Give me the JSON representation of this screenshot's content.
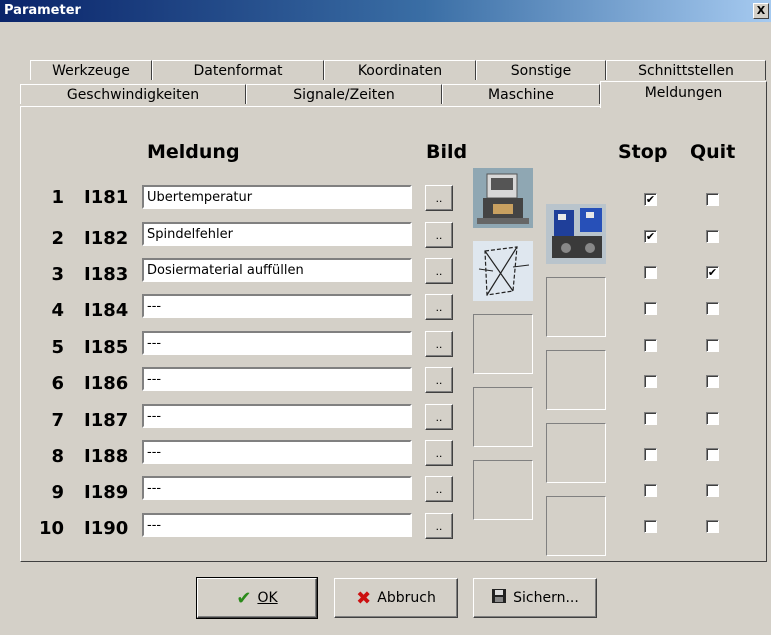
{
  "window": {
    "title": "Parameter",
    "close_glyph": "X"
  },
  "tabs_row1": [
    "Werkzeuge",
    "Datenformat",
    "Koordinaten",
    "Sonstige",
    "Schnittstellen"
  ],
  "tabs_row2": [
    "Geschwindigkeiten",
    "Signale/Zeiten",
    "Maschine",
    "Meldungen"
  ],
  "active_tab": "Meldungen",
  "headers": {
    "meldung": "Meldung",
    "bild": "Bild",
    "stop": "Stop",
    "quit": "Quit"
  },
  "rows": [
    {
      "num": "1",
      "code": "I181",
      "text": "Übertemperatur",
      "stop": true,
      "quit": false
    },
    {
      "num": "2",
      "code": "I182",
      "text": "Spindelfehler",
      "stop": true,
      "quit": false
    },
    {
      "num": "3",
      "code": "I183",
      "text": "Dosiermaterial auffüllen",
      "stop": false,
      "quit": true
    },
    {
      "num": "4",
      "code": "I184",
      "text": "---",
      "stop": false,
      "quit": false
    },
    {
      "num": "5",
      "code": "I185",
      "text": "---",
      "stop": false,
      "quit": false
    },
    {
      "num": "6",
      "code": "I186",
      "text": "---",
      "stop": false,
      "quit": false
    },
    {
      "num": "7",
      "code": "I187",
      "text": "---",
      "stop": false,
      "quit": false
    },
    {
      "num": "8",
      "code": "I188",
      "text": "---",
      "stop": false,
      "quit": false
    },
    {
      "num": "9",
      "code": "I189",
      "text": "---",
      "stop": false,
      "quit": false
    },
    {
      "num": "10",
      "code": "I190",
      "text": "---",
      "stop": false,
      "quit": false
    }
  ],
  "browse_label": "..",
  "check_glyph": "✔",
  "buttons": {
    "ok": {
      "label": "OK",
      "icon": "checkmark-icon"
    },
    "cancel": {
      "label": "Abbruch",
      "icon": "x-icon"
    },
    "save": {
      "label": "Sichern...",
      "icon": "floppy-disk-icon"
    }
  },
  "colors": {
    "title_start": "#0a246a",
    "ok_green": "#2a8a1a",
    "cancel_red": "#cc1010"
  }
}
